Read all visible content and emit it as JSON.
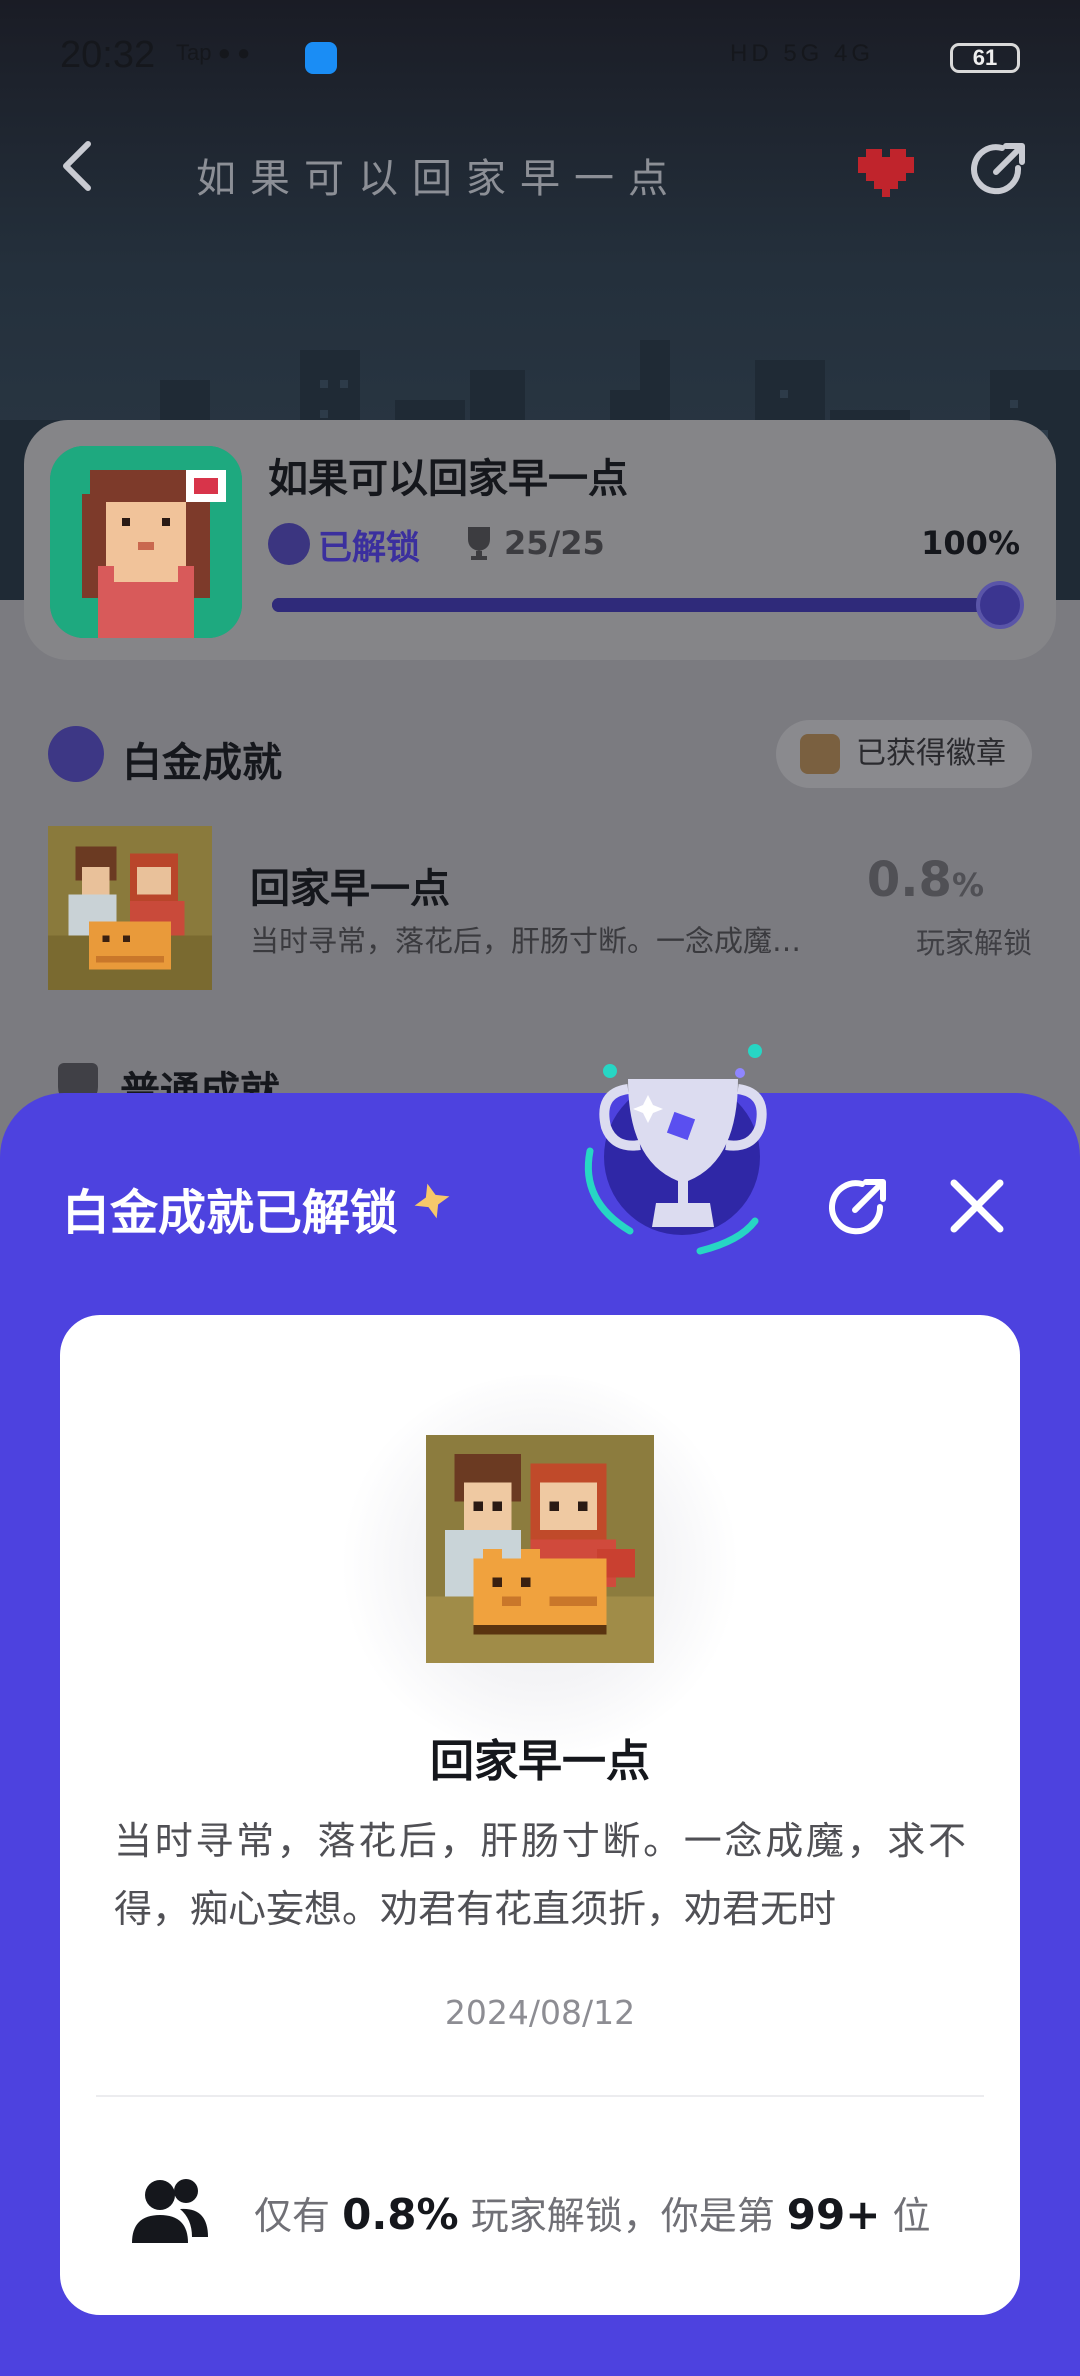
{
  "status_bar": {
    "time": "20:32",
    "app_icons": "Tap ● ●",
    "network": "HD 5G 4G",
    "battery": "61"
  },
  "header": {
    "pixel_title": "如果可以回家早一点",
    "back_icon": "chevron-left-icon",
    "heart_icon": "pixel-heart-icon",
    "share_icon": "share-icon"
  },
  "game_card": {
    "name": "如果可以回家早一点",
    "unlock_status": "已解锁",
    "trophies": "25/25",
    "percent": "100%",
    "progress": 1.0,
    "accent": "#3b2f9e"
  },
  "platinum_section": {
    "title": "白金成就",
    "badge_label": "已获得徽章"
  },
  "achievement": {
    "name": "回家早一点",
    "description": "当时寻常，落花后，肝肠寸断。一念成魔…",
    "percent_value": "0.8",
    "percent_unit": "%",
    "percent_label": "玩家解锁"
  },
  "normal_section": {
    "title": "普通成就"
  },
  "sheet": {
    "title": "白金成就已解锁",
    "background": "#4d42df",
    "card": {
      "name": "回家早一点",
      "description": "当时寻常，落花后，肝肠寸断。一念成魔，求不得，痴心妄想。劝君有花直须折，劝君无时",
      "date": "2024/08/12",
      "footer_prefix": "仅有",
      "footer_percent": "0.8%",
      "footer_middle": "玩家解锁，你是第",
      "footer_rank": "99+",
      "footer_suffix": "位"
    }
  }
}
